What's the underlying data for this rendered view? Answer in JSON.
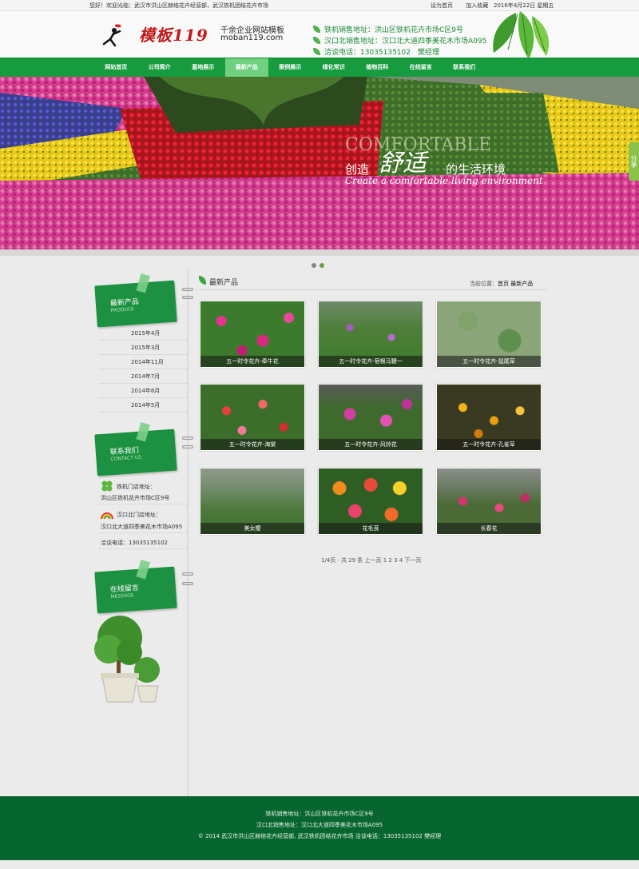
{
  "topbar": {
    "welcome": "您好！欢迎光临：武汉市洪山区赫络花卉经营部，武汉铁机团结花卉市场",
    "set_home": "设为首页",
    "favorite": "加入收藏",
    "date": "2016年4月22日 星期五"
  },
  "header": {
    "logo_text": "模板119",
    "slogan": "千余企业网站模板",
    "site": "moban119.com",
    "addresses": [
      "铁机销售地址：洪山区铁机花卉市场C区9号",
      "汉口北销售地址：汉口北大道四季美花木市场A095",
      "洽谈电话：13035135102　樊经理"
    ]
  },
  "nav": {
    "items": [
      "网站首页",
      "公司简介",
      "基地展示",
      "最新产品",
      "案例展示",
      "绿化常识",
      "植物百科",
      "在线留言",
      "联系我们"
    ],
    "active_index": 3
  },
  "banner": {
    "word_en_big": "COMFORTABLE",
    "slogan_prefix": "创造",
    "slogan_art": "舒适",
    "slogan_suffix": "的生活环境",
    "slogan_en": "Create a comfortable living environment",
    "share": "分享"
  },
  "sidebar": {
    "products": {
      "title": "最新产品",
      "en": "PRODUCE"
    },
    "months": [
      "2015年4月",
      "2015年3月",
      "2014年11月",
      "2014年7月",
      "2014年6月",
      "2014年5月"
    ],
    "contact": {
      "title": "联系我们",
      "en": "CONTACT US",
      "store1_label": "铁机门店地址：",
      "store1_addr": "洪山区铁机花卉市场C区9号",
      "store2_label": "汉口北门店地址：",
      "store2_addr": "汉口北大道四季美花木市场A095",
      "phone": "洽谈电话：13035135102"
    },
    "message": {
      "title": "在线留言",
      "en": "MESSAGE"
    }
  },
  "main": {
    "title": "最新产品",
    "crumb_prefix": "当前位置：",
    "crumb_home": "首页",
    "crumb_sep": "  ",
    "crumb_current": "最新产品",
    "products": [
      "五一时令花卉-牵牛花",
      "五一时令花卉-宿根马鞭一",
      "五一时令花卉-鼠尾草",
      "五一时令花卉-海棠",
      "五一时令花卉-风铃花",
      "五一时令花卉-孔雀草",
      "美女樱",
      "花毛茛",
      "长春花"
    ],
    "pager": "1/4页 · 共 29 条  上一页 1 2 3 4 下一页"
  },
  "footer": {
    "line1": "铁机销售地址：洪山区铁机花卉市场C区9号",
    "line2": "汉口北销售地址：汉口北大道四季美花木市场A095",
    "line3": "© 2014 武汉市洪山区赫络花卉经营部, 武汉铁机团结花卉市场   洽谈电话：13035135102  樊经理"
  },
  "colors": {
    "brand_green": "#179b3f",
    "footer_green": "#07652f",
    "nav_active": "#6fd17f"
  }
}
